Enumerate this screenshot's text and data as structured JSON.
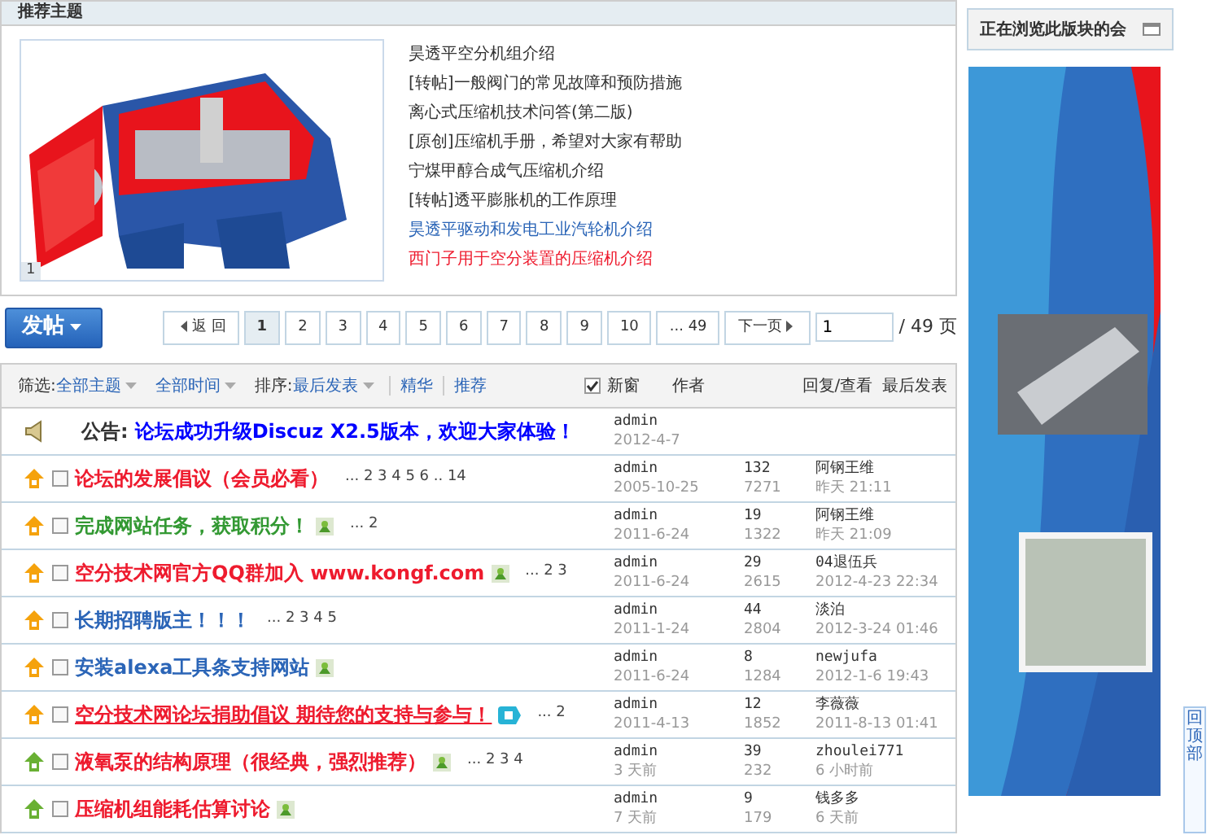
{
  "recommended": {
    "title": "推荐主题",
    "slide_number": "1",
    "items": [
      {
        "text": "昊透平空分机组介绍",
        "color": "#333333"
      },
      {
        "text": "[转帖]一般阀门的常见故障和预防措施",
        "color": "#333333"
      },
      {
        "text": "离心式压缩机技术问答(第二版)",
        "color": "#333333"
      },
      {
        "text": "[原创]压缩机手册，希望对大家有帮助",
        "color": "#333333"
      },
      {
        "text": "宁煤甲醇合成气压缩机介绍",
        "color": "#333333"
      },
      {
        "text": "[转帖]透平膨胀机的工作原理",
        "color": "#333333"
      },
      {
        "text": "昊透平驱动和发电工业汽轮机介绍",
        "color": "#2b65b7"
      },
      {
        "text": "西门子用于空分装置的压缩机介绍",
        "color": "#ee1b2e"
      }
    ]
  },
  "post_button": {
    "label": "发帖"
  },
  "pagination": {
    "back": "返 回",
    "pages": [
      {
        "label": "1",
        "selected": true
      },
      {
        "label": "2",
        "selected": false
      },
      {
        "label": "3",
        "selected": false
      },
      {
        "label": "4",
        "selected": false
      },
      {
        "label": "5",
        "selected": false
      },
      {
        "label": "6",
        "selected": false
      },
      {
        "label": "7",
        "selected": false
      },
      {
        "label": "8",
        "selected": false
      },
      {
        "label": "9",
        "selected": false
      },
      {
        "label": "10",
        "selected": false
      },
      {
        "label": "... 49",
        "selected": false
      }
    ],
    "next": "下一页",
    "page_input": "1",
    "total": "/ 49 页"
  },
  "filter_bar": {
    "filter_label": "筛选:",
    "filters": [
      "全部主题",
      "全部时间"
    ],
    "sort_label": "排序:",
    "sort": "最后发表",
    "links": [
      "精华",
      "推荐"
    ],
    "new_window": {
      "label": "新窗",
      "checked": true
    },
    "columns": [
      "作者",
      "回复/查看",
      "最后发表"
    ]
  },
  "threads": [
    {
      "kind": "announcement",
      "prefix": "公告:",
      "title": "论坛成功升级Discuz X2.5版本，欢迎大家体验！",
      "color": "#0000ff",
      "author": "admin",
      "date": "2012-4-7"
    },
    {
      "kind": "top",
      "checked": false,
      "title": "论坛的发展倡议（会员必看）",
      "color": "#ee1b2e",
      "pages": "... 2 3 4 5 6 .. 14",
      "author": "admin",
      "date": "2005-10-25",
      "replies": "132",
      "views": "7271",
      "last_user": "阿钢王维",
      "last_time": "昨天 21:11"
    },
    {
      "kind": "top",
      "checked": false,
      "title": "完成网站任务，获取积分！",
      "color": "#339933",
      "image_icon": true,
      "pages": "... 2",
      "author": "admin",
      "date": "2011-6-24",
      "replies": "19",
      "views": "1322",
      "last_user": "阿钢王维",
      "last_time": "昨天 21:09"
    },
    {
      "kind": "top",
      "checked": false,
      "title": "空分技术网官方QQ群加入 www.kongf.com",
      "color": "#ee1b2e",
      "image_icon": true,
      "pages": "... 2 3",
      "author": "admin",
      "date": "2011-6-24",
      "replies": "29",
      "views": "2615",
      "last_user": "04退伍兵",
      "last_time": "2012-4-23 22:34"
    },
    {
      "kind": "top",
      "checked": false,
      "title": "长期招聘版主！！！",
      "color": "#2b65b7",
      "pages": "... 2 3 4 5",
      "author": "admin",
      "date": "2011-1-24",
      "replies": "44",
      "views": "2804",
      "last_user": "淡泊",
      "last_time": "2012-3-24 01:46"
    },
    {
      "kind": "top",
      "checked": false,
      "title": "安装alexa工具条支持网站",
      "color": "#2b65b7",
      "image_icon": true,
      "author": "admin",
      "date": "2011-6-24",
      "replies": "8",
      "views": "1284",
      "last_user": "newjufa",
      "last_time": "2012-1-6 19:43"
    },
    {
      "kind": "top",
      "checked": false,
      "title": "空分技术网论坛捐助倡议 期待您的支持与参与！",
      "color": "#ee1b2e",
      "underline": true,
      "digest_icon": true,
      "pages": "... 2",
      "author": "admin",
      "date": "2011-4-13",
      "replies": "12",
      "views": "1852",
      "last_user": "李薇薇",
      "last_time": "2011-8-13 01:41"
    },
    {
      "kind": "forum_top",
      "checked": false,
      "title": "液氧泵的结构原理（很经典，强烈推荐）",
      "color": "#ee1b2e",
      "image_icon": true,
      "pages": "... 2 3 4",
      "author": "admin",
      "date": "3 天前",
      "replies": "39",
      "views": "232",
      "last_user": "zhoulei771",
      "last_time": "6 小时前"
    },
    {
      "kind": "forum_top",
      "checked": false,
      "title": "压缩机组能耗估算讨论",
      "color": "#ee1b2e",
      "image_icon": true,
      "author": "admin",
      "date": "7 天前",
      "replies": "9",
      "views": "179",
      "last_user": "钱多多",
      "last_time": "6 天前"
    }
  ],
  "sidebar": {
    "title": "正在浏览此版块的会",
    "back_to_top": "回顶部"
  }
}
